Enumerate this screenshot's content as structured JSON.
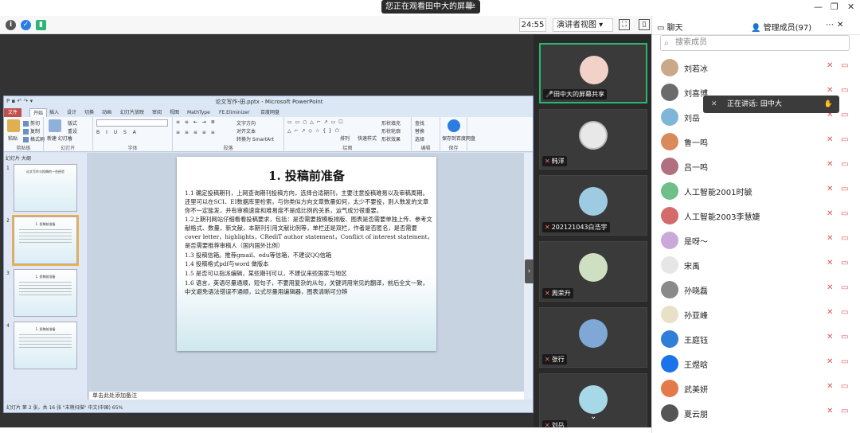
{
  "top": {
    "share_notice": "您正在观看田中大的屏幕",
    "share_arrows": "⇄",
    "min": "—",
    "restore": "❐",
    "close": "✕"
  },
  "toolbar": {
    "info_icon": "i",
    "shield_icon": "✓",
    "signal_icon": "▮",
    "timer": "24:55",
    "view_mode": "演讲者视图"
  },
  "ppt": {
    "window_title": "论文写作-田.pptx - Microsoft PowerPoint",
    "tabs": [
      "文件",
      "开始",
      "插入",
      "设计",
      "切换",
      "动画",
      "幻灯片放映",
      "审阅",
      "视图",
      "MathType",
      "FE.Eliminizer",
      "百度网盘"
    ],
    "ribbon": {
      "paste": "粘贴",
      "cut": "剪切",
      "copy": "复制",
      "format_painter": "格式刷",
      "clipboard": "剪贴板",
      "new_slide": "新建\n幻灯片",
      "layout": "版式",
      "reset": "重设",
      "section": "节",
      "slides": "幻灯片",
      "font": "字体",
      "paragraph": "段落",
      "text_direction": "文字方向",
      "align_text": "对齐文本",
      "smartart": "转换为 SmartArt",
      "arrange": "排列",
      "quick_styles": "快速样式",
      "shape_fill": "形状填充",
      "shape_outline": "形状轮廓",
      "shape_effects": "形状效果",
      "drawing": "绘图",
      "find": "查找",
      "replace": "替换",
      "select": "选择",
      "editing": "编辑",
      "save_to_baidu": "保存到百度网盘",
      "save": "保存"
    },
    "thumb_tabs": "幻灯片  大纲",
    "thumbs": [
      {
        "num": "1",
        "title": "论文写作与投稿的一些经验"
      },
      {
        "num": "2",
        "title": "1. 投稿前准备"
      },
      {
        "num": "3",
        "title": "1. 投稿前准备"
      },
      {
        "num": "4",
        "title": "1. 投稿前准备"
      }
    ],
    "slide": {
      "heading": "1. 投稿前准备",
      "paragraphs": [
        "1.1 确定投稿期刊，上网查询期刊投稿方向，选择合适期刊，主要注意投稿难易以及审稿周期。还里可以在SCI、EI数据库里检索，与你类似方向文章数量如何，太少不要投，则人数发的文章你不一定能发，并有审稿速度和难易度不是成比例的关系，运气成分很重要。",
        "1.2上期刊网站仔细看看投稿要求，包括：是否需要按模板排版、图表是否需要单独上传、参考文献格式、数量，新文献，本期刊引用文献比例等，单栏还是双栏，作者是否匿名，是否需要cover letter，highlights，CRediT author statement，Conflict of interest statement，是否需要推荐审稿人（国内国外比例）",
        "1.3 投稿信箱。推荐gmail、edu等信箱，不建议QQ信箱",
        "1.4 投稿格式pdf与word 做版本",
        "1.5 是否可以指派编辑，某些期刊可以，不建议来些国家与地区",
        "1.6 语言，英语尽量通顺，短句子，不要用复杂的从句，关键词用常见的翻译，前后全文一致，中文避免语法错误不通顺，公式尽量用编辑器，图表清晰可分辨"
      ]
    },
    "notes": "单击此处添加备注",
    "status": "幻灯片 第 2 张，共 16 张   \"末梢扫描\"   中文(中国)                                      65%"
  },
  "videos": [
    {
      "name": "田中大的屏幕共享",
      "color": "#f2d1c8"
    },
    {
      "name": "韩洋",
      "color": "#e8e8e8"
    },
    {
      "name": "202121043白浩宇",
      "color": "#9ecbe2"
    },
    {
      "name": "周荣升",
      "color": "#cfe0c2"
    },
    {
      "name": "张行",
      "color": "#7fa8d6"
    },
    {
      "name": "刘岳",
      "color": "#a7d8e8"
    }
  ],
  "panel": {
    "chat_tab": "聊天",
    "members_tab": "管理成员(97)",
    "more": "⋯",
    "close": "✕",
    "search_placeholder": "搜索成员",
    "speaking": "正在讲话: 田中大",
    "members": [
      {
        "name": "刘若冰",
        "color": "#c9a98a"
      },
      {
        "name": "刘喜博",
        "color": "#6b6b6b"
      },
      {
        "name": "刘岳",
        "color": "#7fb6d8"
      },
      {
        "name": "鲁一鸣",
        "color": "#d98a5a"
      },
      {
        "name": "吕一鸣",
        "color": "#b07080"
      },
      {
        "name": "人工智能2001时毓",
        "color": "#6fbf8a"
      },
      {
        "name": "人工智能2003李慧婕",
        "color": "#d46a6a"
      },
      {
        "name": "是呀～",
        "color": "#c9a9d9"
      },
      {
        "name": "宋禹",
        "color": "#e6e6e6"
      },
      {
        "name": "孙晓磊",
        "color": "#8a8a8a"
      },
      {
        "name": "孙亚峰",
        "color": "#e9e0c8"
      },
      {
        "name": "王庭钰",
        "color": "#2f7fd9"
      },
      {
        "name": "王煜晗",
        "color": "#1a73e8"
      },
      {
        "name": "武美妍",
        "color": "#e27a4c"
      },
      {
        "name": "夏云朋",
        "color": "#555555"
      }
    ]
  }
}
